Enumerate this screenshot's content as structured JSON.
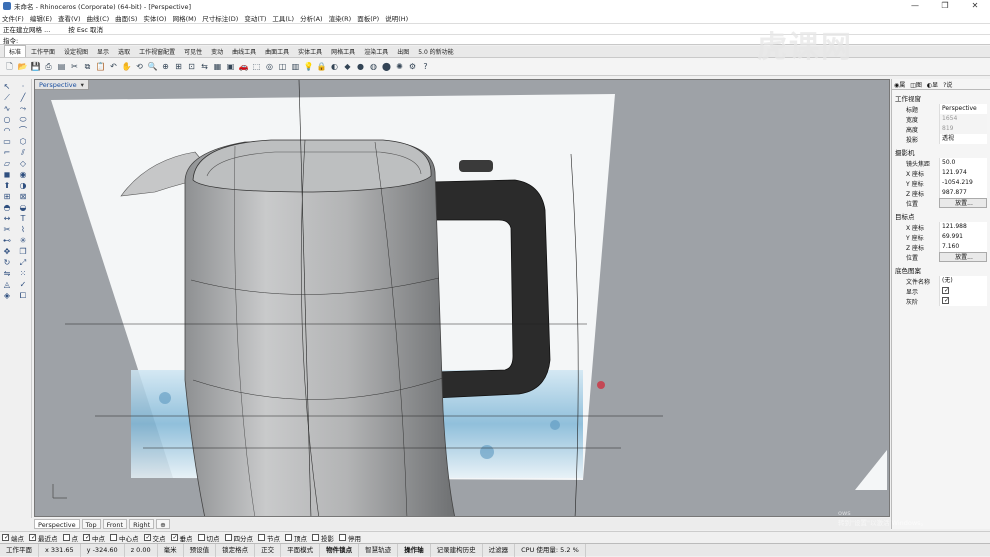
{
  "window": {
    "title": "未命名 - Rhinoceros (Corporate) (64-bit) - [Perspective]",
    "controls": [
      "—",
      "❐",
      "✕"
    ]
  },
  "menu": [
    "文件(F)",
    "编辑(E)",
    "查看(V)",
    "曲线(C)",
    "曲面(S)",
    "实体(O)",
    "网格(M)",
    "尺寸标注(D)",
    "变动(T)",
    "工具(L)",
    "分析(A)",
    "渲染(R)",
    "面板(P)",
    "说明(H)"
  ],
  "command": {
    "history": "正在建立网格 ...",
    "hint": "按 Esc 取消",
    "prompt": "指令:",
    "value": ""
  },
  "toolbar_tabs": [
    "标准",
    "工作平面",
    "设定视图",
    "显示",
    "选取",
    "工作视窗配置",
    "可见性",
    "变动",
    "曲线工具",
    "曲面工具",
    "实体工具",
    "网格工具",
    "渲染工具",
    "出图",
    "5.0 的新功能"
  ],
  "active_tab_index": 0,
  "viewport": {
    "name": "Perspective",
    "tabs": [
      "Perspective",
      "Top",
      "Front",
      "Right",
      "⊕"
    ]
  },
  "osnaps": [
    {
      "label": "端点",
      "on": true
    },
    {
      "label": "最近点",
      "on": true
    },
    {
      "label": "点",
      "on": false
    },
    {
      "label": "中点",
      "on": true
    },
    {
      "label": "中心点",
      "on": false
    },
    {
      "label": "交点",
      "on": true
    },
    {
      "label": "垂点",
      "on": true
    },
    {
      "label": "切点",
      "on": false
    },
    {
      "label": "四分点",
      "on": false
    },
    {
      "label": "节点",
      "on": false
    },
    {
      "label": "顶点",
      "on": false
    },
    {
      "label": "投影",
      "on": false
    },
    {
      "label": "停用",
      "on": false
    }
  ],
  "status": {
    "cplane": "工作平面",
    "x": "x 331.65",
    "y": "y -324.60",
    "z": "z 0.00",
    "unit": "毫米",
    "layer": "预设值",
    "items": [
      "锁定格点",
      "正交",
      "平面模式",
      "物件锁点",
      "智慧轨迹",
      "操作轴",
      "记录建构历史",
      "过滤器"
    ],
    "cpu": "CPU 使用量: 5.2 %"
  },
  "properties": {
    "section_viewport": "工作视窗",
    "title_label": "标题",
    "title_value": "Perspective",
    "width_label": "宽度",
    "width_value": "1654",
    "height_label": "高度",
    "height_value": "819",
    "projection_label": "投影",
    "projection_value": "透视",
    "section_camera": "摄影机",
    "lens_label": "镜头焦距",
    "lens_value": "50.0",
    "camx_label": "X 座标",
    "camx_value": "121.974",
    "camy_label": "Y 座标",
    "camy_value": "-1054.219",
    "camz_label": "Z 座标",
    "camz_value": "987.877",
    "pos_label": "位置",
    "pos_button": "放置...",
    "section_target": "目标点",
    "tx_label": "X 座标",
    "tx_value": "121.988",
    "ty_label": "Y 座标",
    "ty_value": "69.991",
    "tz_label": "Z 座标",
    "tz_value": "7.160",
    "tpos_label": "位置",
    "tpos_button": "放置...",
    "section_bg": "底色图案",
    "file_label": "文件名称",
    "file_value": "(无)",
    "show_label": "显示",
    "gray_label": "灰阶"
  },
  "watermark": {
    "logo": "虎课网",
    "win1": "ows",
    "win2": "转到\"设置\"以激活 Windows。"
  },
  "colors": {
    "viewport_bg": "#9ea2a7",
    "kettle_body": "#a9abad",
    "handle": "#2b2b2b"
  }
}
